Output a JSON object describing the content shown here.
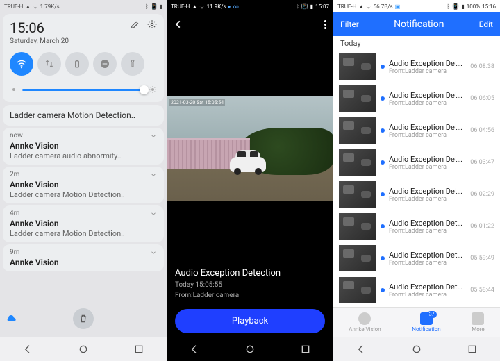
{
  "screen1": {
    "status": {
      "carrier": "TRUE-H",
      "rate": "1.79K/s",
      "time": ""
    },
    "time": "15:06",
    "date": "Saturday, March 20",
    "notif_header": "Ladder camera Motion Detection..",
    "notifs": [
      {
        "age": "now",
        "app": "Annke Vision",
        "body": "Ladder camera audio abnormity.."
      },
      {
        "age": "2m",
        "app": "Annke Vision",
        "body": "Ladder camera Motion Detection.."
      },
      {
        "age": "4m",
        "app": "Annke Vision",
        "body": "Ladder camera Motion Detection.."
      },
      {
        "age": "9m",
        "app": "Annke Vision",
        "body": ""
      }
    ]
  },
  "screen2": {
    "status": {
      "carrier": "TRUE-H",
      "rate": "11.9K/s",
      "time": "15:07"
    },
    "overlay_ts": "2021-03-20 Sat 15:05:54",
    "event_title": "Audio Exception Detection",
    "event_time": "Today 15:05:55",
    "event_from": "From:Ladder camera",
    "playback": "Playback"
  },
  "screen3": {
    "status": {
      "carrier": "TRUE-H",
      "rate": "66.7B/s",
      "batt": "100%",
      "time": "15:16"
    },
    "filter": "Filter",
    "title": "Notification",
    "edit": "Edit",
    "section": "Today",
    "rows": [
      {
        "title": "Audio Exception Detecti..",
        "from": "From:Ladder camera",
        "time": "06:08:38"
      },
      {
        "title": "Audio Exception Detecti..",
        "from": "From:Ladder camera",
        "time": "06:06:05"
      },
      {
        "title": "Audio Exception Detecti..",
        "from": "From:Ladder camera",
        "time": "06:04:56"
      },
      {
        "title": "Audio Exception Detecti..",
        "from": "From:Ladder camera",
        "time": "06:03:47"
      },
      {
        "title": "Audio Exception Detecti..",
        "from": "From:Ladder camera",
        "time": "06:02:29"
      },
      {
        "title": "Audio Exception Detecti..",
        "from": "From:Ladder camera",
        "time": "06:01:22"
      },
      {
        "title": "Audio Exception Detecti..",
        "from": "From:Ladder camera",
        "time": "05:59:49"
      },
      {
        "title": "Audio Exception Detecti..",
        "from": "From:Ladder camera",
        "time": "05:58:44"
      }
    ],
    "tabs": {
      "vision": "Annke Vision",
      "notif": "Notification",
      "badge": "37",
      "more": "More"
    }
  }
}
